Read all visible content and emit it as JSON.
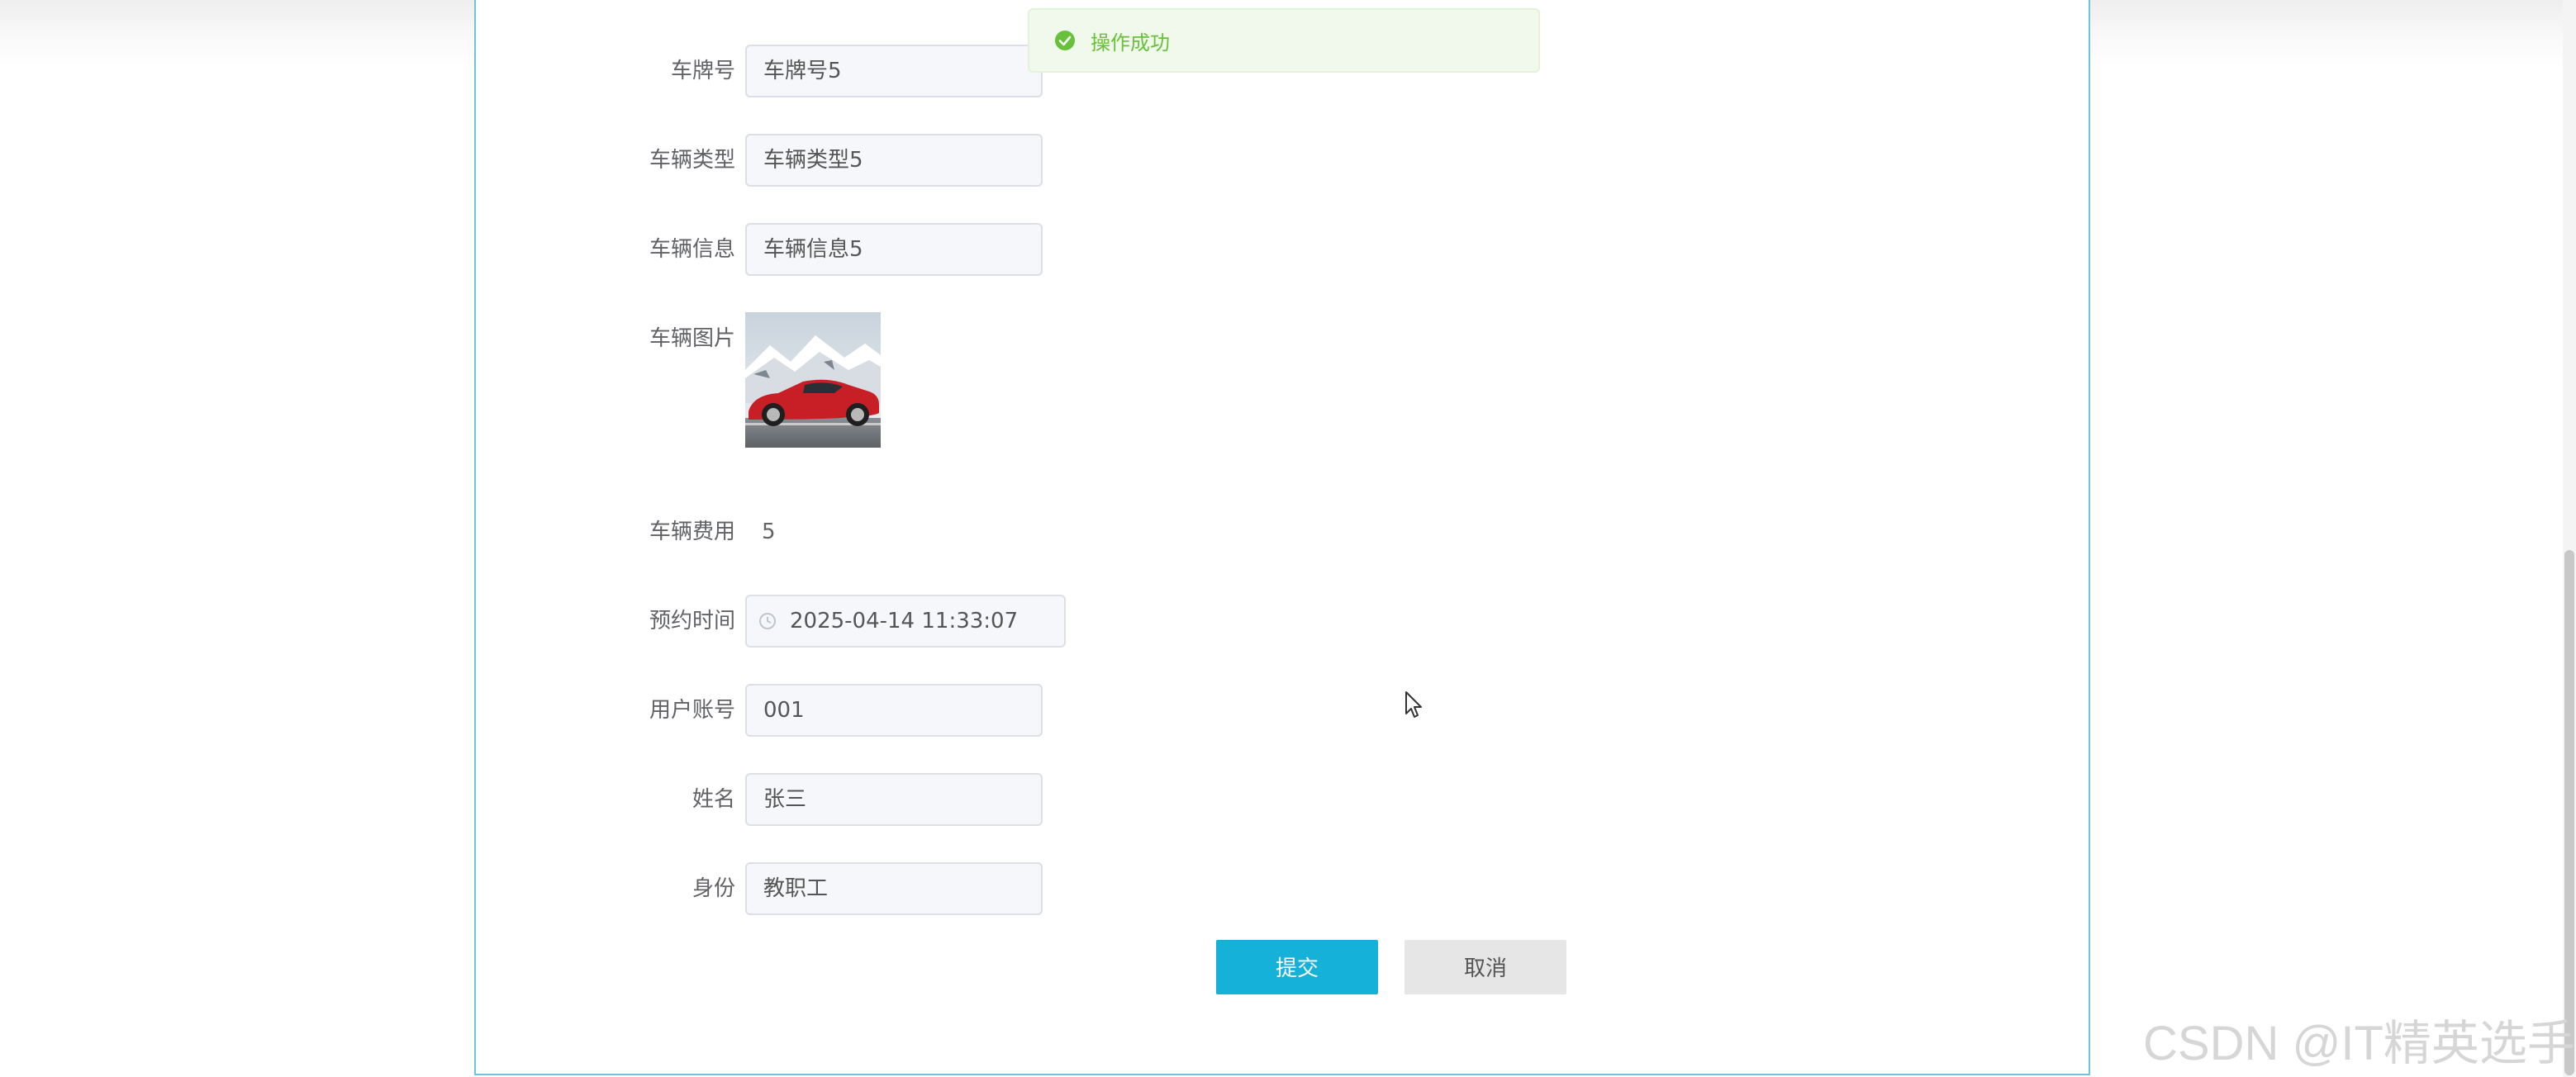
{
  "toast": {
    "message": "操作成功",
    "icon": "check-circle-icon",
    "color": "#67c23a"
  },
  "form": {
    "plate": {
      "label": "车牌号",
      "value": "车牌号5"
    },
    "vehicle_type": {
      "label": "车辆类型",
      "value": "车辆类型5"
    },
    "vehicle_info": {
      "label": "车辆信息",
      "value": "车辆信息5"
    },
    "vehicle_image": {
      "label": "车辆图片"
    },
    "vehicle_fee": {
      "label": "车辆费用",
      "value": "5"
    },
    "booking_time": {
      "label": "预约时间",
      "value": "2025-04-14 11:33:07",
      "icon": "clock-icon"
    },
    "user_account": {
      "label": "用户账号",
      "value": "001"
    },
    "name": {
      "label": "姓名",
      "value": "张三"
    },
    "identity": {
      "label": "身份",
      "value": "教职工"
    }
  },
  "buttons": {
    "submit": "提交",
    "cancel": "取消"
  },
  "watermark": "CSDN @IT精英选手",
  "colors": {
    "accent": "#16b1d9",
    "panel_border": "#6fc3de",
    "success": "#67c23a"
  }
}
